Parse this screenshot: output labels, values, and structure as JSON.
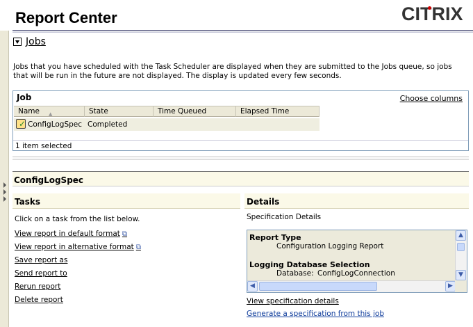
{
  "header": {
    "title": "Report Center",
    "logo_text": "CITRIX"
  },
  "jobs": {
    "label": "Jobs",
    "description": "Jobs that you have scheduled with the Task Scheduler are displayed when they are submitted to the Jobs queue, so jobs that will be run in the future are not displayed.  The display is updated every few seconds.",
    "panel_title": "Job",
    "choose_columns": "Choose columns",
    "columns": [
      "Name",
      "State",
      "Time Queued",
      "Elapsed Time"
    ],
    "rows": [
      {
        "name": "ConfigLogSpec",
        "state": "Completed",
        "time_queued": "",
        "elapsed_time": ""
      }
    ],
    "selected_text": "1 item selected"
  },
  "selected_job": {
    "name": "ConfigLogSpec"
  },
  "tasks": {
    "title": "Tasks",
    "intro": "Click on a task from the list below.",
    "links": [
      {
        "label": "View report in default format",
        "external": true
      },
      {
        "label": "View report in alternative format",
        "external": true
      },
      {
        "label": "Save report as",
        "external": false
      },
      {
        "label": "Send report to",
        "external": false
      },
      {
        "label": "Rerun report",
        "external": false
      },
      {
        "label": "Delete report",
        "external": false
      }
    ]
  },
  "details": {
    "title": "Details",
    "spec_label": "Specification Details",
    "report_type_label": "Report Type",
    "report_type_value": "Configuration Logging Report",
    "db_selection_label": "Logging Database Selection",
    "database_label": "Database:",
    "database_value": "ConfigLogConnection",
    "links": [
      {
        "label": "View specification details"
      },
      {
        "label": "Generate a specification from this job"
      }
    ]
  },
  "icons": {
    "external_link": "external-link-icon",
    "job_status": "job-complete-icon"
  }
}
